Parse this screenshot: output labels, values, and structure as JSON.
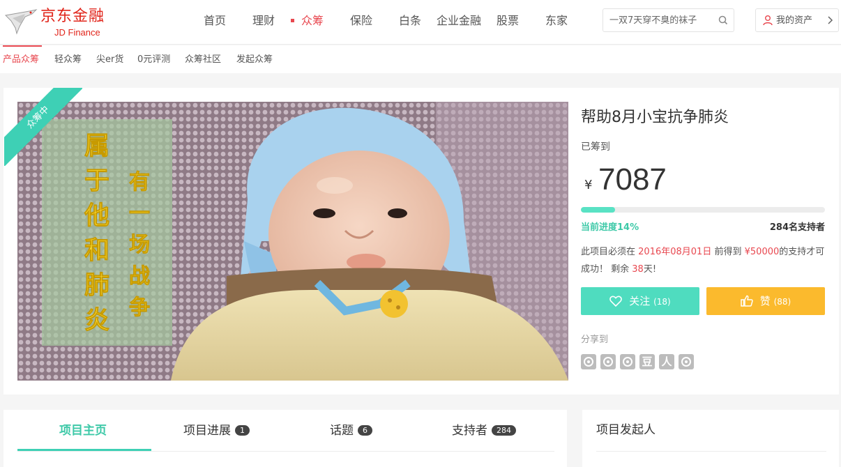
{
  "brand": {
    "name_cn": "京东金融",
    "name_en": "JD Finance",
    "color": "#e1251b"
  },
  "nav": {
    "items": [
      {
        "label": "首页"
      },
      {
        "label": "理财"
      },
      {
        "label": "众筹",
        "active": true
      },
      {
        "label": "保险"
      },
      {
        "label": "白条"
      },
      {
        "label": "企业金融"
      },
      {
        "label": "股票"
      },
      {
        "label": "东家"
      }
    ]
  },
  "search": {
    "placeholder": "一双7天穿不臭的袜子",
    "icon": "search-icon"
  },
  "account": {
    "label": "我的资产",
    "icon": "user-icon"
  },
  "subnav": {
    "items": [
      {
        "label": "产品众筹",
        "active": true
      },
      {
        "label": "轻众筹"
      },
      {
        "label": "尖er货"
      },
      {
        "label": "0元评测"
      },
      {
        "label": "众筹社区"
      },
      {
        "label": "发起众筹"
      }
    ]
  },
  "project": {
    "status_ribbon": "众筹中",
    "title": "帮助8月小宝抗争肺炎",
    "raised_label": "已筹到",
    "currency_symbol": "¥",
    "amount": "7087",
    "progress_text": "当前进度14%",
    "progress_fraction": 0.14,
    "supporters": "284名支持者",
    "terms": {
      "pre": "此项目必须在",
      "deadline": "2016年08月01日",
      "mid": "前得到",
      "goal": "¥50000",
      "post": "的支持才可成功！ 剩余",
      "days": "38",
      "days_suffix": "天!"
    },
    "follow": {
      "label": "关注",
      "count": "(18)"
    },
    "like": {
      "label": "赞",
      "count": "(88)"
    },
    "share_label": "分享到",
    "share_icons": [
      "weibo-icon",
      "qq-weibo-icon",
      "qzone-icon",
      "douban-icon",
      "renren-icon",
      "wechat-icon"
    ],
    "share_glyphs": [
      "",
      "",
      "",
      "豆",
      "人",
      ""
    ],
    "image_text": {
      "vertical_left": "属于他和肺炎",
      "vertical_right": "有一场战争"
    }
  },
  "tabs": [
    {
      "label": "项目主页",
      "active": true,
      "badge": ""
    },
    {
      "label": "项目进展",
      "badge": "1"
    },
    {
      "label": "话题",
      "badge": "6"
    },
    {
      "label": "支持者",
      "badge": "284"
    }
  ],
  "sidebar": {
    "title": "项目发起人"
  },
  "colors": {
    "accent_red": "#e8474f",
    "accent_teal": "#3ed0b5",
    "like_yellow": "#fbba2d"
  }
}
